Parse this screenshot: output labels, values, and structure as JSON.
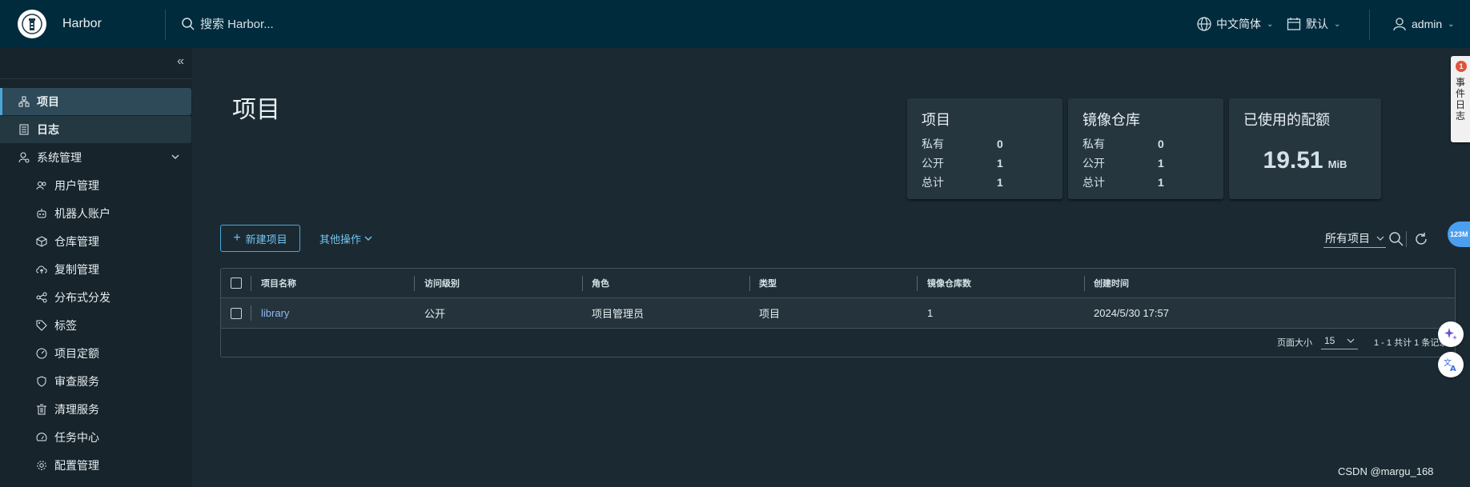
{
  "header": {
    "app_title": "Harbor",
    "search_placeholder": "搜索 Harbor...",
    "language": "中文简体",
    "datetime_format": "默认",
    "user": "admin"
  },
  "sidebar": {
    "items": [
      {
        "label": "项目",
        "icon": "projects-icon"
      },
      {
        "label": "日志",
        "icon": "logs-icon"
      },
      {
        "label": "系统管理",
        "icon": "admin-icon"
      },
      {
        "label": "用户管理",
        "icon": "users-icon"
      },
      {
        "label": "机器人账户",
        "icon": "robot-icon"
      },
      {
        "label": "仓库管理",
        "icon": "box-icon"
      },
      {
        "label": "复制管理",
        "icon": "cloud-upload-icon"
      },
      {
        "label": "分布式分发",
        "icon": "share-icon"
      },
      {
        "label": "标签",
        "icon": "tag-icon"
      },
      {
        "label": "项目定额",
        "icon": "dashboard-icon"
      },
      {
        "label": "审查服务",
        "icon": "shield-icon"
      },
      {
        "label": "清理服务",
        "icon": "trash-icon"
      },
      {
        "label": "任务中心",
        "icon": "speedometer-icon"
      },
      {
        "label": "配置管理",
        "icon": "gear-icon"
      }
    ]
  },
  "main": {
    "page_title": "项目",
    "cards": {
      "projects": {
        "title": "项目",
        "rows": [
          {
            "label": "私有",
            "value": "0"
          },
          {
            "label": "公开",
            "value": "1"
          },
          {
            "label": "总计",
            "value": "1"
          }
        ]
      },
      "repositories": {
        "title": "镜像仓库",
        "rows": [
          {
            "label": "私有",
            "value": "0"
          },
          {
            "label": "公开",
            "value": "1"
          },
          {
            "label": "总计",
            "value": "1"
          }
        ]
      },
      "quota": {
        "title": "已使用的配额",
        "value": "19.51",
        "unit": "MiB"
      }
    },
    "new_project_label": "新建项目",
    "more_actions_label": "其他操作",
    "filter_value": "所有项目",
    "table": {
      "headers": [
        "项目名称",
        "访问级别",
        "角色",
        "类型",
        "镜像仓库数",
        "创建时间"
      ],
      "rows": [
        {
          "name": "library",
          "access": "公开",
          "role": "项目管理员",
          "type": "项目",
          "repo_count": "1",
          "created": "2024/5/30 17:57"
        }
      ],
      "page_size_label": "页面大小",
      "page_size": "15",
      "summary": "1 - 1 共计 1 条记录"
    }
  },
  "overlay": {
    "event_log": "事件日志",
    "event_count": "1",
    "memory_badge": "123M",
    "watermark": "CSDN @margu_168"
  },
  "colors": {
    "header_bg": "#002b3d",
    "sidebar_bg": "#17242b",
    "main_bg": "#1b2a32",
    "accent": "#4aa6d9",
    "link": "#8fb9f0"
  }
}
